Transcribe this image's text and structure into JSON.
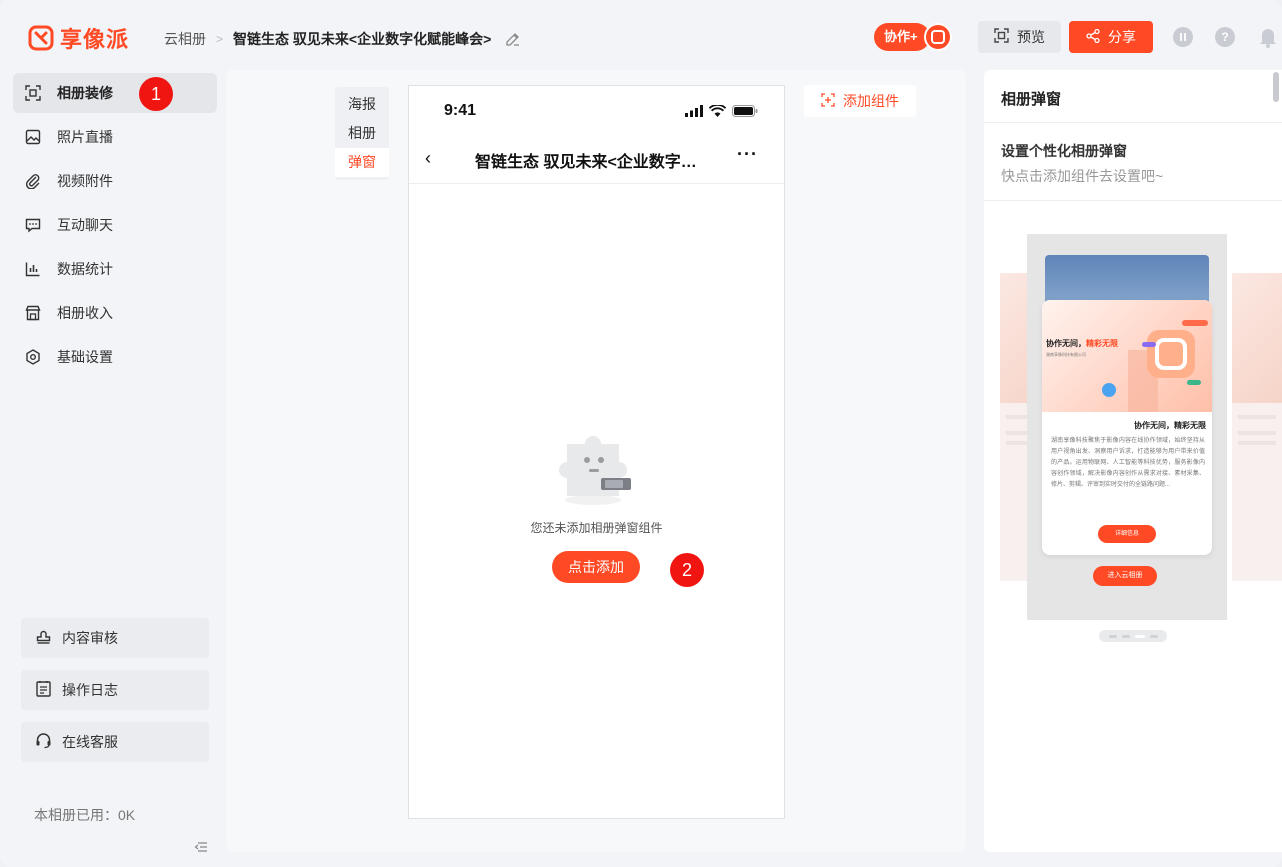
{
  "header": {
    "logo_text": "享像派",
    "breadcrumb_root": "云相册",
    "breadcrumb_sep": ">",
    "album_title": "智链生态 驭见未来<企业数字化赋能峰会>",
    "collab_label": "协作+",
    "preview_label": "预览",
    "share_label": "分享",
    "help_glyph": "?"
  },
  "sidebar": {
    "items": [
      {
        "label": "相册装修",
        "icon": "scan-frame-icon",
        "active": true
      },
      {
        "label": "照片直播",
        "icon": "image-icon"
      },
      {
        "label": "视频附件",
        "icon": "paperclip-icon"
      },
      {
        "label": "互动聊天",
        "icon": "chat-icon"
      },
      {
        "label": "数据统计",
        "icon": "bar-chart-icon"
      },
      {
        "label": "相册收入",
        "icon": "shop-icon"
      },
      {
        "label": "基础设置",
        "icon": "gear-icon"
      }
    ],
    "tools": [
      {
        "label": "内容审核",
        "icon": "stamp-icon"
      },
      {
        "label": "操作日志",
        "icon": "log-icon"
      },
      {
        "label": "在线客服",
        "icon": "headset-icon"
      }
    ],
    "usage": "本相册已用：0K"
  },
  "annotations": {
    "one": "1",
    "two": "2"
  },
  "editor": {
    "tabs": [
      {
        "label": "海报"
      },
      {
        "label": "相册"
      },
      {
        "label": "弹窗",
        "active": true
      }
    ],
    "add_component_label": "添加组件",
    "phone": {
      "time": "9:41",
      "back_glyph": "‹",
      "title": "智链生态 驭见未来<企业数字化赋能峰会>",
      "more_glyph": "···",
      "empty_text": "您还未添加相册弹窗组件",
      "add_button": "点击添加"
    }
  },
  "right_panel": {
    "title": "相册弹窗",
    "subtitle": "设置个性化相册弹窗",
    "hint": "快点击添加组件去设置吧~",
    "preview": {
      "banner_title_a": "协作无间，",
      "banner_title_b": "精彩无限",
      "banner_sub": "湖南享像科技有限公司",
      "popup_title": "协作无间，精彩无限",
      "popup_body": "湖南享像科技聚焦于影像内容在线协作领域，始终坚持从用户视角出发、洞察用户诉求，打造能够为用户带来价值的产品。运用物联网、人工智能等科技优势，服务影像内容创作领域，解决影像内容创作从需求对接、素材采集、修片、剪辑、评审到实时交付的全链路问题...",
      "detail_button": "详细信息",
      "enter_button": "进入云相册"
    }
  },
  "colors": {
    "accent": "#ff4a25",
    "badge": "#f01510"
  }
}
